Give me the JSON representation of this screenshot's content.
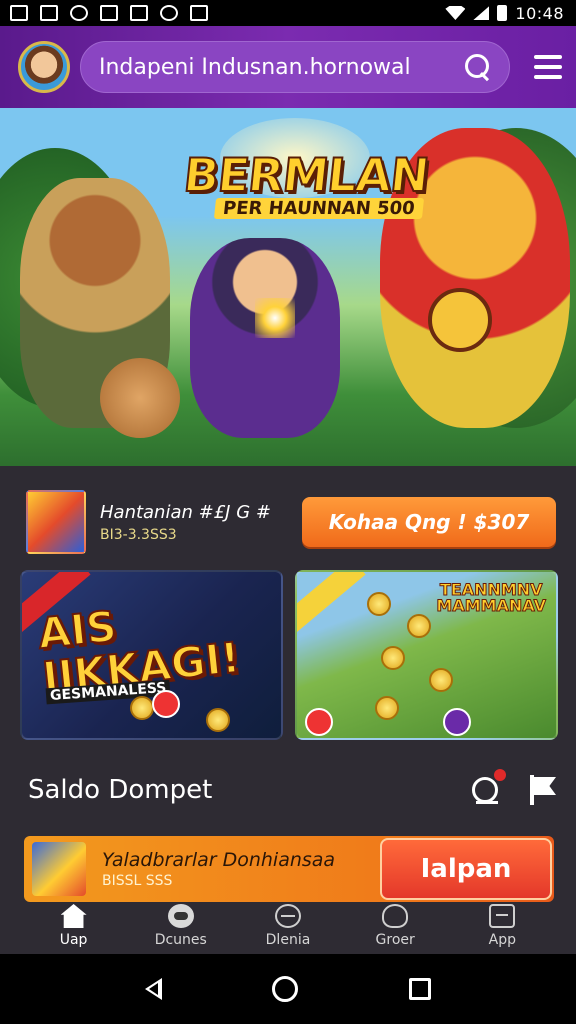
{
  "status_bar": {
    "time": "10:48"
  },
  "app_bar": {
    "search_value": "Indapeni Indusnan.hornowal",
    "icons": [
      "avatar",
      "search-icon",
      "menu-icon"
    ]
  },
  "hero": {
    "title": "BERMLAN",
    "subtitle": "PER HAUNNAN 500"
  },
  "promo": {
    "title": "Hantanian #£J G #",
    "subtitle": "BI3-3.3SS3",
    "button_label": "Kohaa Qng !   $307"
  },
  "cards": [
    {
      "title_line1": "AIS",
      "title_line2": "IIKKAGI!",
      "subtitle": "GESMANALESS"
    },
    {
      "title_line1": "TEANNMNV",
      "title_line2": "MAMMANAV"
    }
  ],
  "wallet": {
    "title": "Saldo Dompet"
  },
  "bonus": {
    "title": "Yaladbrarlar Donhiansaa",
    "subtitle": "BISSL SSS",
    "button_label": "Ialpan"
  },
  "bottom_nav": [
    {
      "label": "Uap",
      "icon": "home-icon"
    },
    {
      "label": "Dcunes",
      "icon": "games-icon"
    },
    {
      "label": "Dlenia",
      "icon": "promo-icon"
    },
    {
      "label": "Groer",
      "icon": "user-icon"
    },
    {
      "label": "App",
      "icon": "app-icon"
    }
  ],
  "colors": {
    "app_bar": "#6a1fa3",
    "accent_orange": "#f07a1a",
    "content_bg": "#2e2b33"
  }
}
